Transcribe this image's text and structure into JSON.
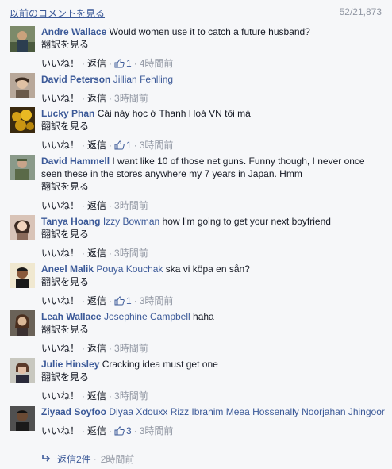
{
  "header": {
    "prev_link": "以前のコメントを見る",
    "count": "52/21,873"
  },
  "actions": {
    "like": "いいね！",
    "reply": "返信",
    "dot": "·"
  },
  "comments": [
    {
      "author": "Andre Wallace",
      "tag": "",
      "text": "Would women use it to catch a future husband?",
      "translate": "翻訳を見る",
      "likes": "1",
      "time": "4時間前"
    },
    {
      "author": "David Peterson",
      "tag": "Jillian Fehlling",
      "text": "",
      "translate": "",
      "likes": "",
      "time": "3時間前"
    },
    {
      "author": "Lucky Phan",
      "tag": "",
      "text": "Cái này học ở Thanh Hoá VN tôi mà",
      "translate": "翻訳を見る",
      "likes": "1",
      "time": "3時間前"
    },
    {
      "author": "David Hammell",
      "tag": "",
      "text": "I want like 10 of those net guns. Funny though, I never once seen these in the stores anywhere my 7 years in Japan. Hmm",
      "translate": "翻訳を見る",
      "likes": "",
      "time": "3時間前"
    },
    {
      "author": "Tanya Hoang",
      "tag": "Izzy Bowman",
      "text": "how I'm going to get your next boyfriend",
      "translate": "翻訳を見る",
      "likes": "",
      "time": "3時間前"
    },
    {
      "author": "Aneel Malik",
      "tag": "Pouya Kouchak",
      "text": "ska vi köpa en sån?",
      "translate": "翻訳を見る",
      "likes": "1",
      "time": "3時間前"
    },
    {
      "author": "Leah Wallace",
      "tag": "Josephine Campbell",
      "text": "haha",
      "translate": "翻訳を見る",
      "likes": "",
      "time": "3時間前"
    },
    {
      "author": "Julie Hinsley",
      "tag": "",
      "text": "Cracking idea must get one",
      "translate": "翻訳を見る",
      "likes": "",
      "time": "3時間前"
    },
    {
      "author": "Ziyaad Soyfoo",
      "tag": "Diyaa Xdouxx Rizz Ibrahim Meea Hossenally Noorjahan Jhingoor",
      "text": "",
      "translate": "",
      "likes": "3",
      "time": "3時間前"
    }
  ],
  "replies": {
    "label": "返信2件",
    "dot": "·",
    "time": "2時間前"
  },
  "colors": {
    "link": "#3b5998",
    "meta": "#9197a3",
    "text": "#141823",
    "background": "#f6f7f9"
  },
  "icons": {
    "like": "thumbs-up-icon",
    "reply": "reply-arrow-icon"
  }
}
